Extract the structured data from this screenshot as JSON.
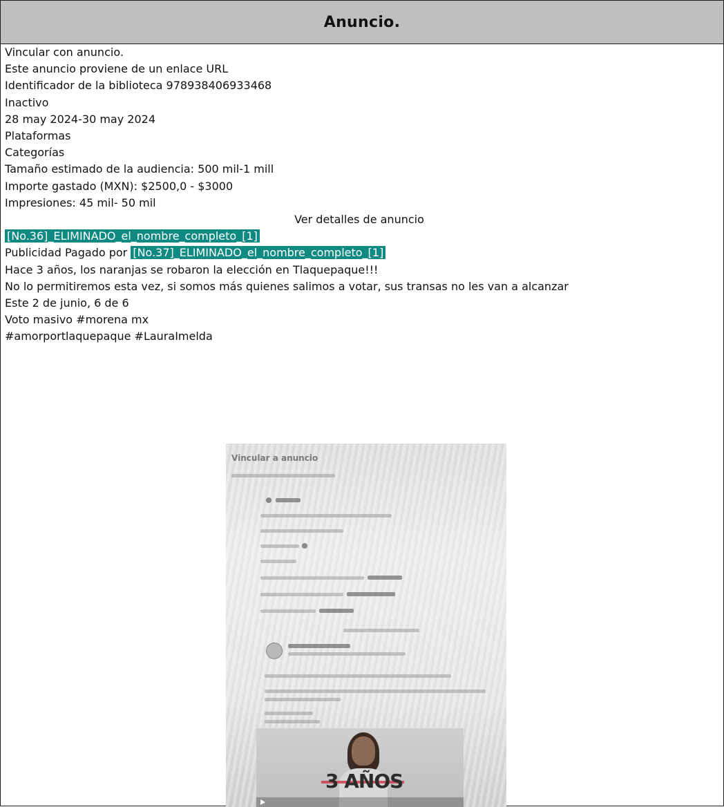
{
  "header": {
    "title": "Anuncio."
  },
  "lines": {
    "l1": "Vincular con anuncio.",
    "l2": "Este anuncio proviene de un enlace URL",
    "l3": "Identificador de la biblioteca 978938406933468",
    "l4": "Inactivo",
    "l5": "28 may 2024-30 may 2024",
    "l6": "Plataformas",
    "l7": "Categorías",
    "l8": "Tamaño estimado de la audiencia: 500 mil-1 mill",
    "l9": "Importe gastado (MXN): $2500,0 - $3000",
    "l10": "Impresiones: 45 mil- 50 mil",
    "l11": "Ver detalles de anuncio",
    "l12": "[No.36]_ELIMINADO_el_nombre_completo_[1]",
    "l13_prefix": "Publicidad Pagado por ",
    "l13_redacted": "[No.37]_ELIMINADO_el_nombre_completo_[1]",
    "l14": "Hace 3 años, los naranjas se robaron la elección en Tlaquepaque!!!",
    "l15": "No lo permitiremos esta vez, si somos más quienes salimos a votar, sus transas no les van a alcanzar",
    "l16": "Este 2 de junio, 6 de 6",
    "l17": "Voto masivo #morena mx",
    "l18": "#amorportlaquepaque #LauraImelda"
  },
  "photo": {
    "heading": "Vincular a anuncio",
    "video_text": "3 AÑOS"
  },
  "colors": {
    "header_bg": "#bfbfbf",
    "redaction_bg": "#0f8a83"
  }
}
